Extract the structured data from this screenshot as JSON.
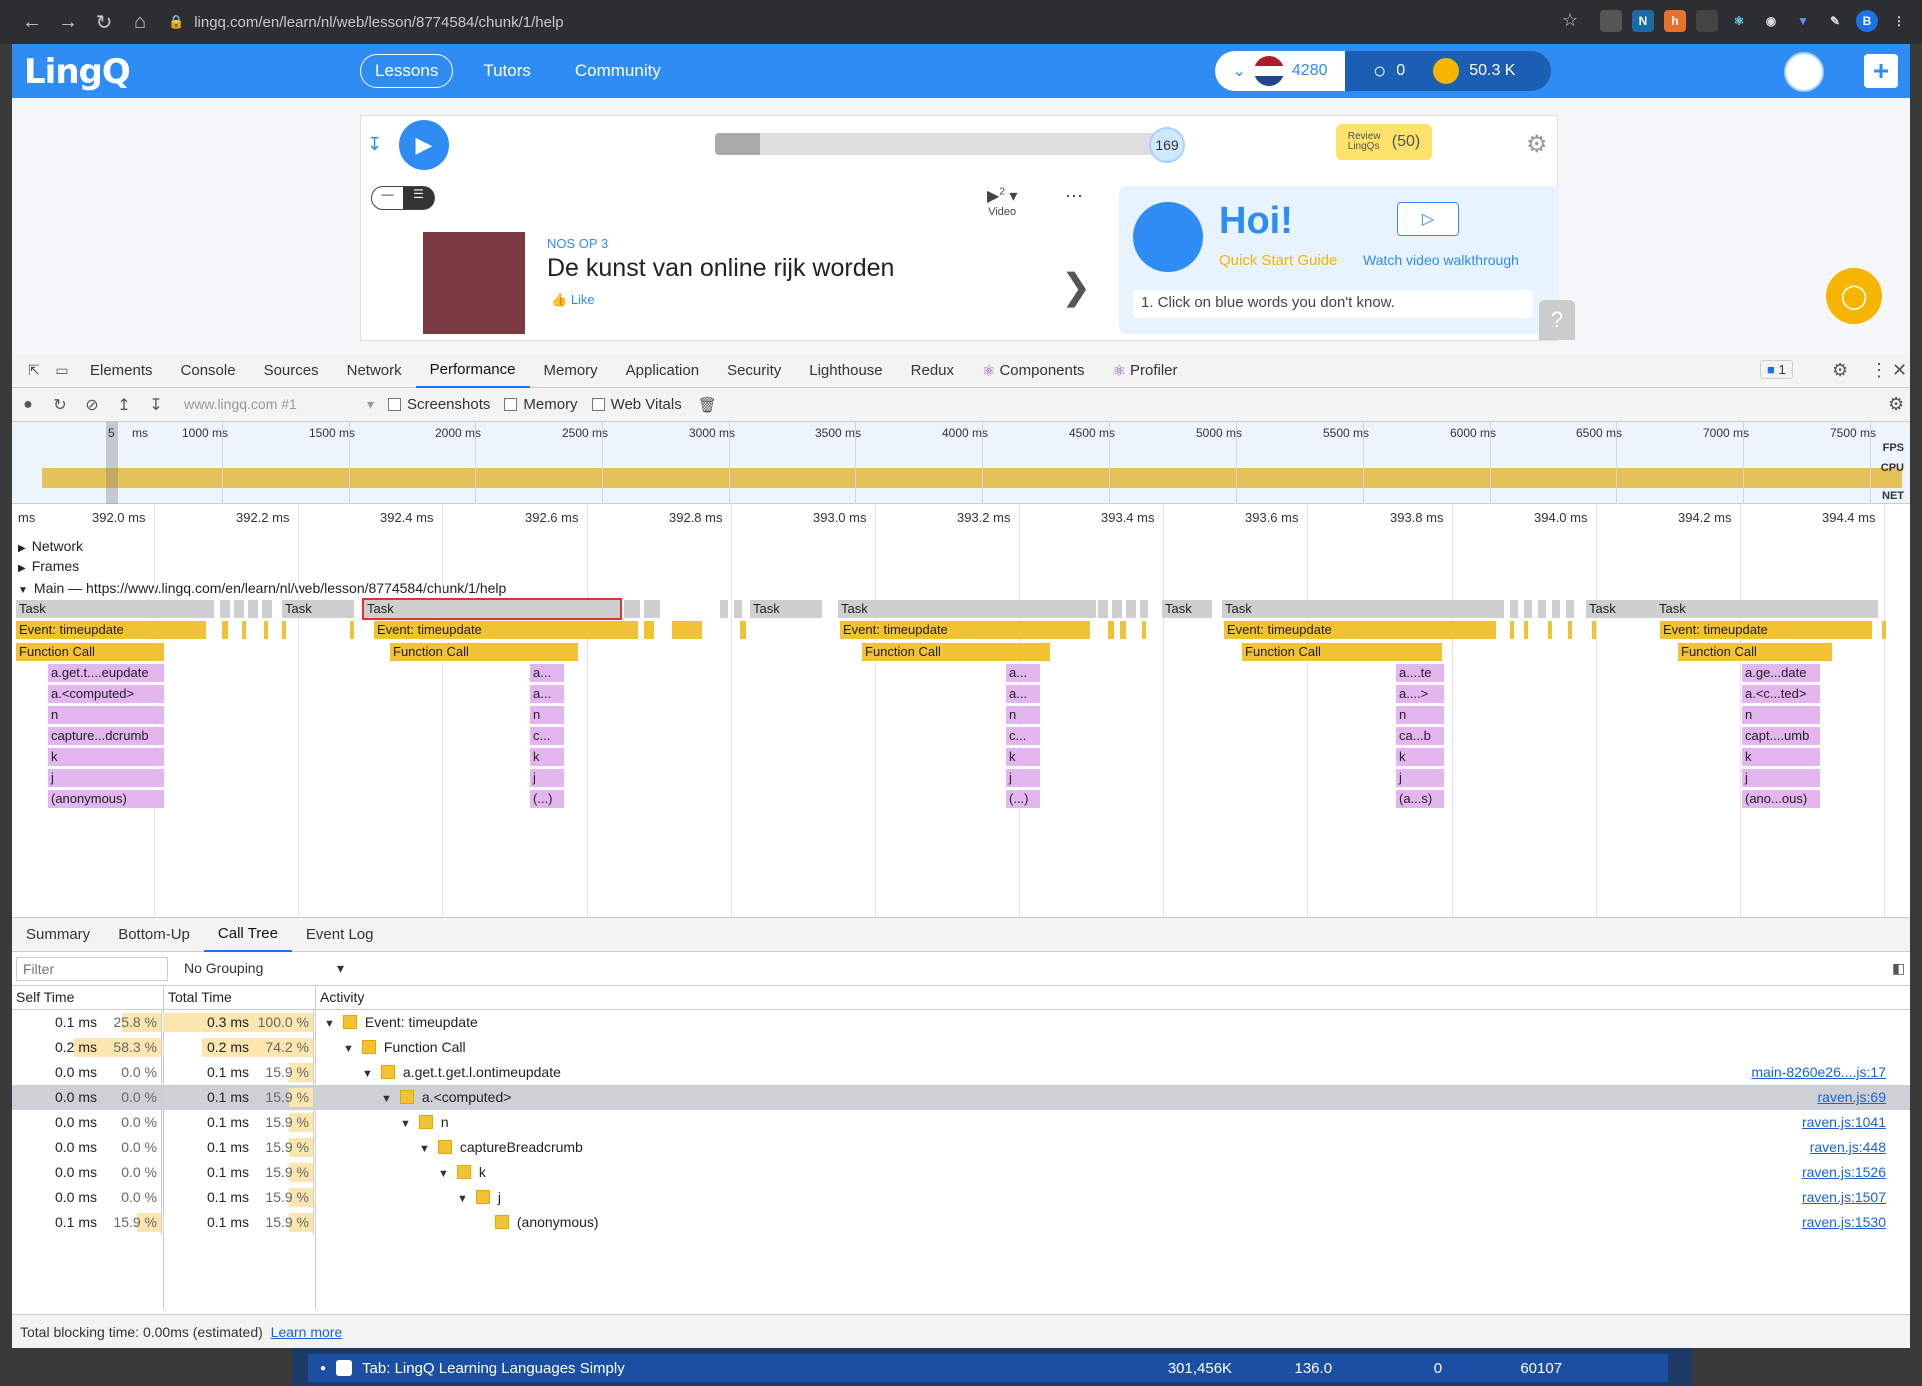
{
  "browser": {
    "url": "lingq.com/en/learn/nl/web/lesson/8774584/chunk/1/help"
  },
  "header": {
    "logo": "LingQ",
    "nav": [
      "Lessons",
      "Tutors",
      "Community"
    ],
    "active_nav": "Lessons",
    "known_words": "4280",
    "streak": "0",
    "coins": "50.3 K"
  },
  "player": {
    "position": "169",
    "progress": 0.1,
    "review_label": "Review LingQs",
    "review_count": "(50)"
  },
  "lesson": {
    "source": "NOS OP 3",
    "title": "De kunst van online rijk worden",
    "like": "Like",
    "video_label": "Video",
    "video_count": "2"
  },
  "guide": {
    "title": "Hoi!",
    "quick_start": "Quick Start Guide",
    "walkthrough": "Watch video walkthrough",
    "tip": "1. Click on blue words you don't know."
  },
  "devtools": {
    "tabs": [
      "Elements",
      "Console",
      "Sources",
      "Network",
      "Performance",
      "Memory",
      "Application",
      "Security",
      "Lighthouse",
      "Redux",
      "Components",
      "Profiler"
    ],
    "active_tab": "Performance",
    "issues_badge": "1",
    "toolbar": {
      "target": "www.lingq.com #1",
      "screenshots": "Screenshots",
      "memory": "Memory",
      "web_vitals": "Web Vitals"
    },
    "overview_ticks": [
      "5",
      "ms",
      "1000 ms",
      "1500 ms",
      "2000 ms",
      "2500 ms",
      "3000 ms",
      "3500 ms",
      "4000 ms",
      "4500 ms",
      "5000 ms",
      "5500 ms",
      "6000 ms",
      "6500 ms",
      "7000 ms",
      "7500 ms"
    ],
    "overview_labels": [
      "FPS",
      "CPU",
      "NET"
    ],
    "ruler_ticks": [
      "ms",
      "392.0 ms",
      "392.2 ms",
      "392.4 ms",
      "392.6 ms",
      "392.8 ms",
      "393.0 ms",
      "393.2 ms",
      "393.4 ms",
      "393.6 ms",
      "393.8 ms",
      "394.0 ms",
      "394.2 ms",
      "394.4 ms"
    ],
    "tracks": {
      "network": "Network",
      "frames": "Frames",
      "main": "Main — https://www.lingq.com/en/learn/nl/web/lesson/8774584/chunk/1/help"
    },
    "flame": {
      "task": "Task",
      "event": "Event: timeupdate",
      "function_call": "Function Call",
      "stack1": [
        "a.get.t....eupdate",
        "a.<computed>",
        "n",
        "capture...dcrumb",
        "k",
        "j",
        "(anonymous)"
      ],
      "stack2": [
        "a...",
        "a...",
        "n",
        "c...",
        "k",
        "j",
        "(...)"
      ],
      "stack3": [
        "a...",
        "a...",
        "n",
        "c...",
        "k",
        "j",
        "(...)"
      ],
      "stack4": [
        "a....te",
        "a....>",
        "n",
        "ca...b",
        "k",
        "j",
        "(a...s)"
      ],
      "stack5": [
        "a.ge...date",
        "a.<c...ted>",
        "n",
        "capt....umb",
        "k",
        "j",
        "(ano...ous)"
      ]
    },
    "bottom_tabs": [
      "Summary",
      "Bottom-Up",
      "Call Tree",
      "Event Log"
    ],
    "active_bottom_tab": "Call Tree",
    "filter_placeholder": "Filter",
    "grouping": "No Grouping",
    "columns": [
      "Self Time",
      "Total Time",
      "Activity"
    ],
    "call_tree": [
      {
        "self": "0.1 ms",
        "self_pct": "25.8 %",
        "total": "0.3 ms",
        "total_pct": "100.0 %",
        "activity": "Event: timeupdate",
        "link": "",
        "depth": 0,
        "expanded": true
      },
      {
        "self": "0.2 ms",
        "self_pct": "58.3 %",
        "total": "0.2 ms",
        "total_pct": "74.2 %",
        "activity": "Function Call",
        "link": "",
        "depth": 1,
        "expanded": true
      },
      {
        "self": "0.0 ms",
        "self_pct": "0.0 %",
        "total": "0.1 ms",
        "total_pct": "15.9 %",
        "activity": "a.get.t.get.l.ontimeupdate",
        "link": "main-8260e26....js:17",
        "depth": 2,
        "expanded": true
      },
      {
        "self": "0.0 ms",
        "self_pct": "0.0 %",
        "total": "0.1 ms",
        "total_pct": "15.9 %",
        "activity": "a.<computed>",
        "link": "raven.js:69",
        "depth": 3,
        "expanded": true,
        "selected": true
      },
      {
        "self": "0.0 ms",
        "self_pct": "0.0 %",
        "total": "0.1 ms",
        "total_pct": "15.9 %",
        "activity": "n",
        "link": "raven.js:1041",
        "depth": 4,
        "expanded": true
      },
      {
        "self": "0.0 ms",
        "self_pct": "0.0 %",
        "total": "0.1 ms",
        "total_pct": "15.9 %",
        "activity": "captureBreadcrumb",
        "link": "raven.js:448",
        "depth": 5,
        "expanded": true
      },
      {
        "self": "0.0 ms",
        "self_pct": "0.0 %",
        "total": "0.1 ms",
        "total_pct": "15.9 %",
        "activity": "k",
        "link": "raven.js:1526",
        "depth": 6,
        "expanded": true
      },
      {
        "self": "0.0 ms",
        "self_pct": "0.0 %",
        "total": "0.1 ms",
        "total_pct": "15.9 %",
        "activity": "j",
        "link": "raven.js:1507",
        "depth": 7,
        "expanded": true
      },
      {
        "self": "0.1 ms",
        "self_pct": "15.9 %",
        "total": "0.1 ms",
        "total_pct": "15.9 %",
        "activity": "(anonymous)",
        "link": "raven.js:1530",
        "depth": 8,
        "expanded": false
      }
    ],
    "footer": {
      "text": "Total blocking time: 0.00ms (estimated)",
      "link": "Learn more"
    }
  },
  "taskbar": {
    "title": "Tab: LingQ Learning Languages Simply",
    "memory": "301,456K",
    "cpu": "136.0",
    "network": "0",
    "pid": "60107"
  },
  "colors": {
    "brand_blue": "#2f8cf2",
    "coin_gold": "#f6b500",
    "task_gray": "#cfcfcf",
    "event_yellow": "#f1c233",
    "js_purple": "#e3b6f0"
  }
}
